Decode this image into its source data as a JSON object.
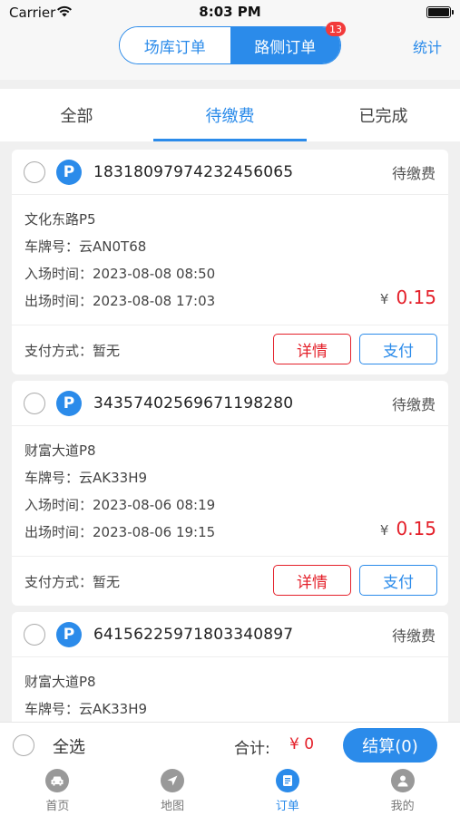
{
  "status_bar": {
    "carrier": "Carrier",
    "time": "8:03 PM"
  },
  "nav": {
    "segments": [
      "场库订单",
      "路侧订单"
    ],
    "badge": "13",
    "stats": "统计"
  },
  "tabs": [
    "全部",
    "待缴费",
    "已完成"
  ],
  "labels": {
    "plate_prefix": "车牌号：",
    "entry_prefix": "入场时间：",
    "exit_prefix": "出场时间：",
    "pay_method_prefix": "支付方式：",
    "currency": "¥",
    "detail_btn": "详情",
    "pay_btn": "支付",
    "p_icon": "P"
  },
  "orders": [
    {
      "order_no": "1831809797423245606​5",
      "status": "待缴费",
      "location": "文化东路P5",
      "plate": "云AN0T68",
      "entry_time": "2023-08-08 08:50",
      "exit_time": "2023-08-08 17:03",
      "amount": "0.15",
      "pay_method": "暂无"
    },
    {
      "order_no": "3435740256967119828​0",
      "status": "待缴费",
      "location": "财富大道P8",
      "plate": "云AK33H9",
      "entry_time": "2023-08-06 08:19",
      "exit_time": "2023-08-06 19:15",
      "amount": "0.15",
      "pay_method": "暂无"
    },
    {
      "order_no": "6415622597180334089​7",
      "status": "待缴费",
      "location": "财富大道P8",
      "plate": "云AK33H9"
    }
  ],
  "checkout": {
    "select_all": "全选",
    "total_label": "合计:",
    "total_value": "¥ 0",
    "settle": "结算(0)"
  },
  "bottom_nav": [
    {
      "label": "首页",
      "icon": "car-icon"
    },
    {
      "label": "地图",
      "icon": "compass-icon"
    },
    {
      "label": "订单",
      "icon": "order-icon"
    },
    {
      "label": "我的",
      "icon": "user-icon"
    }
  ],
  "colors": {
    "accent": "#2b8bea",
    "price": "#e4202a",
    "badge": "#f23a3a"
  }
}
